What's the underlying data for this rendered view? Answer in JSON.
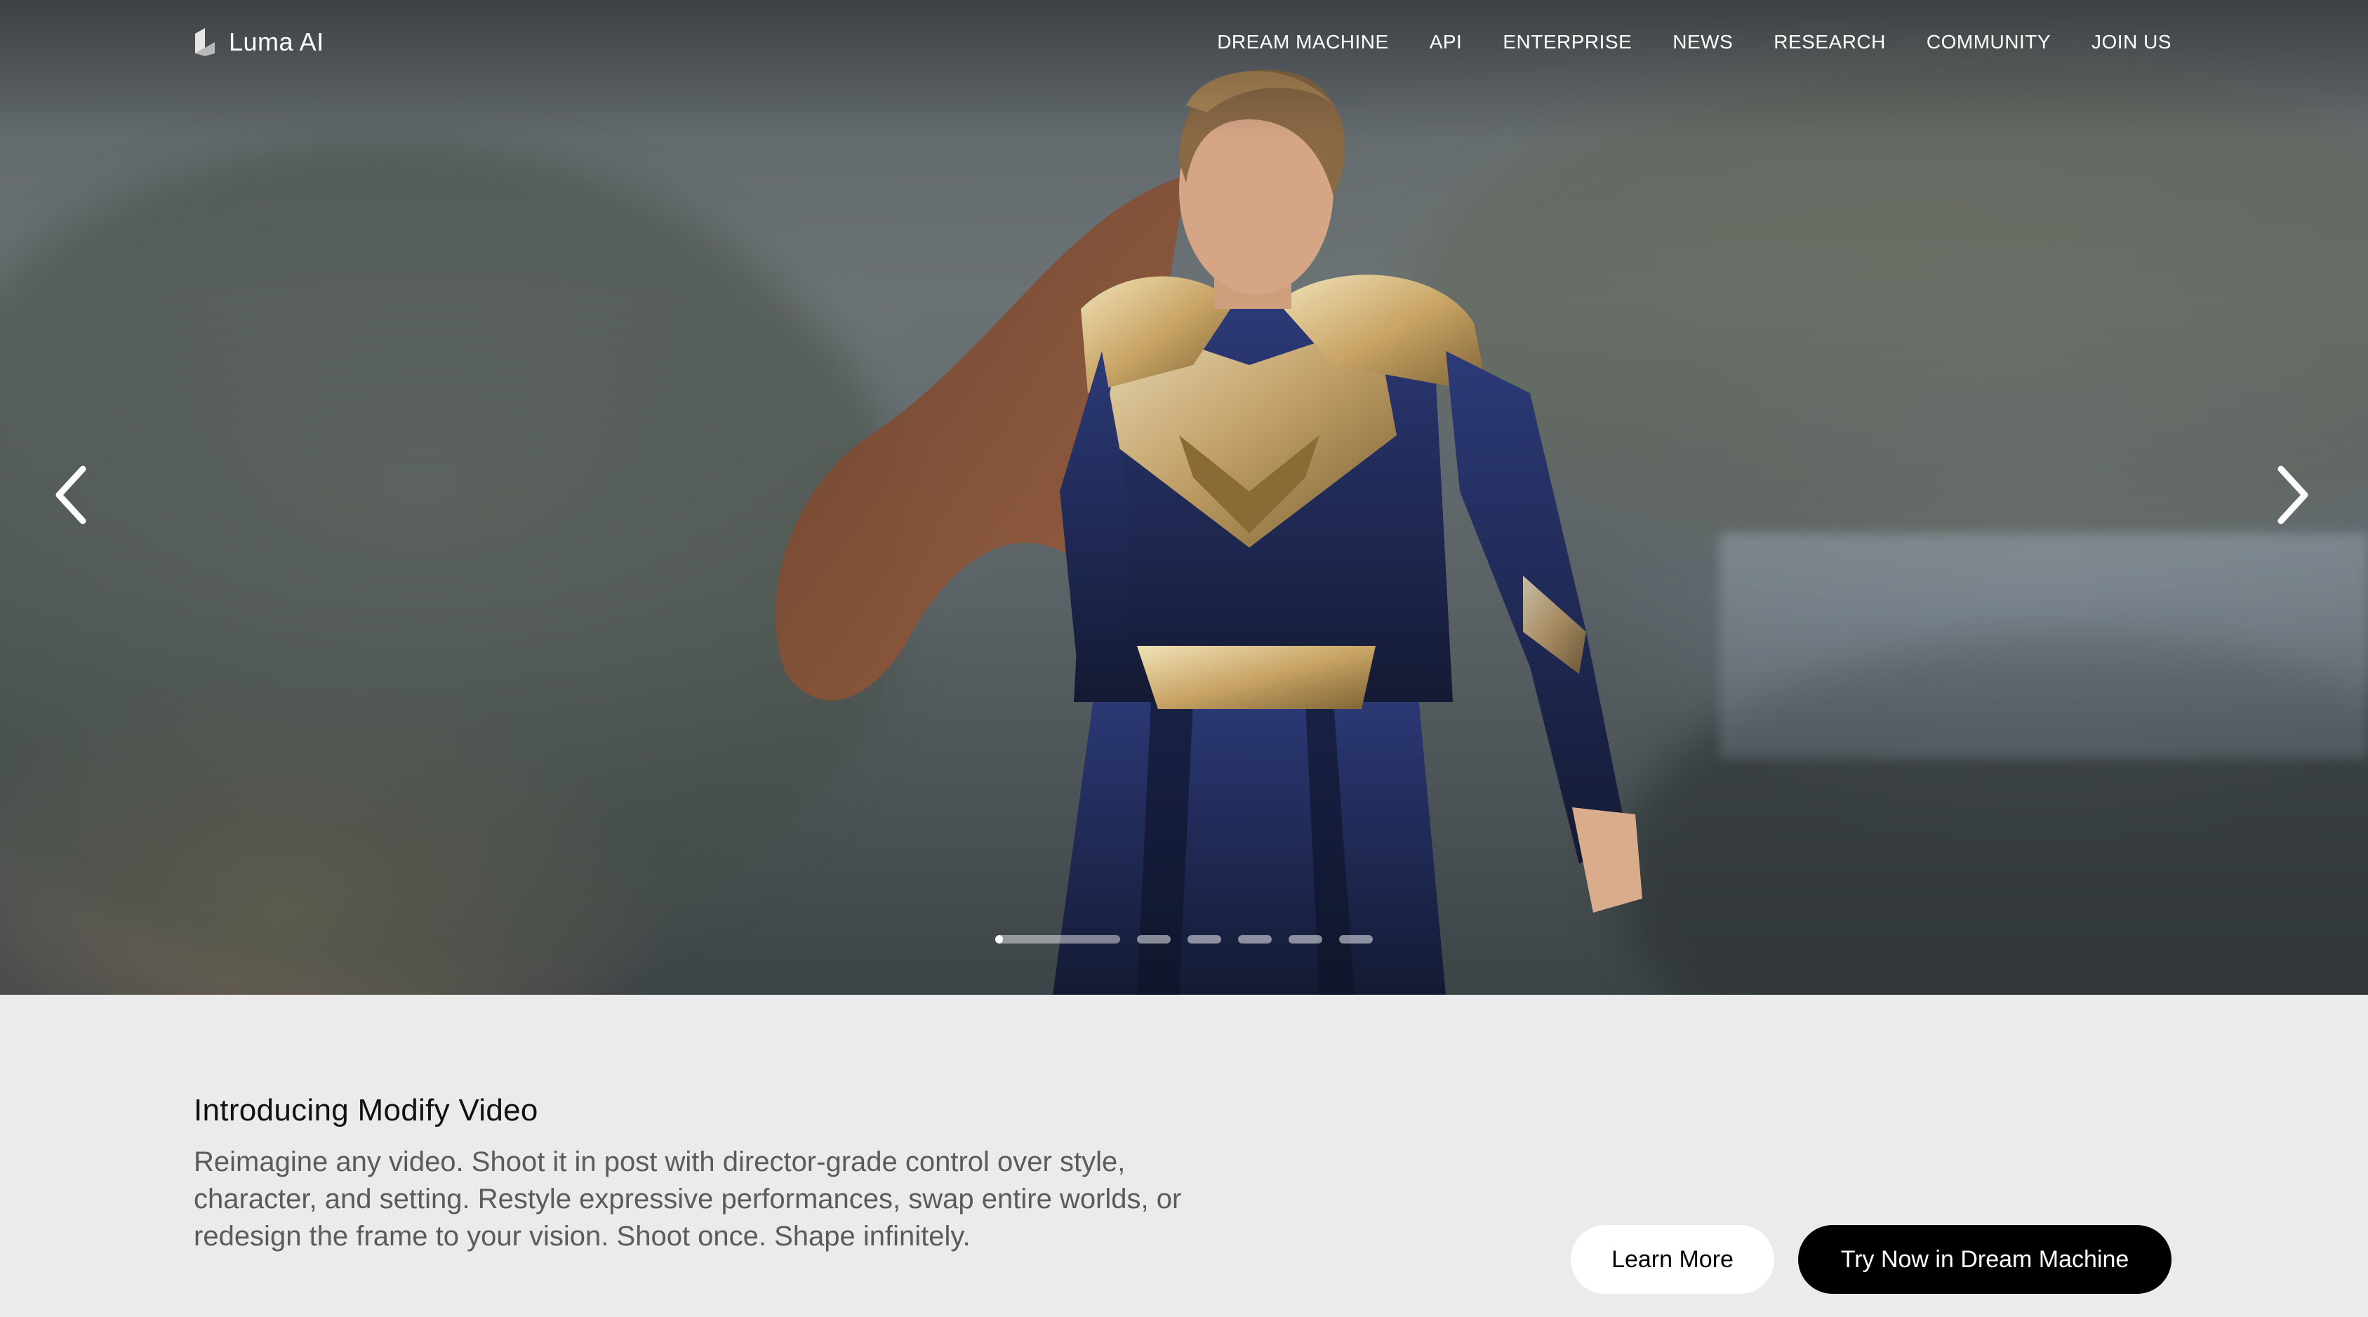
{
  "brand": {
    "name": "Luma AI",
    "logo_icon": "luma-cube-icon"
  },
  "nav": {
    "items": [
      {
        "label": "DREAM MACHINE"
      },
      {
        "label": "API"
      },
      {
        "label": "ENTERPRISE"
      },
      {
        "label": "NEWS"
      },
      {
        "label": "RESEARCH"
      },
      {
        "label": "COMMUNITY"
      },
      {
        "label": "JOIN US"
      }
    ]
  },
  "carousel": {
    "prev_icon": "chevron-left-icon",
    "next_icon": "chevron-right-icon",
    "slide_count": 6,
    "active_index": 0,
    "active_progress": 0.02
  },
  "feature": {
    "title": "Introducing Modify Video",
    "description": "Reimagine any video. Shoot it in post with director-grade control over style, character, and setting. Restyle expressive performances, swap entire worlds, or redesign the frame to your vision. Shoot once. Shape infinitely.",
    "learn_more_label": "Learn More",
    "try_now_label": "Try Now in Dream Machine"
  },
  "colors": {
    "page_background": "#ebebeb",
    "primary_button": "#000000",
    "secondary_button": "#ffffff"
  }
}
